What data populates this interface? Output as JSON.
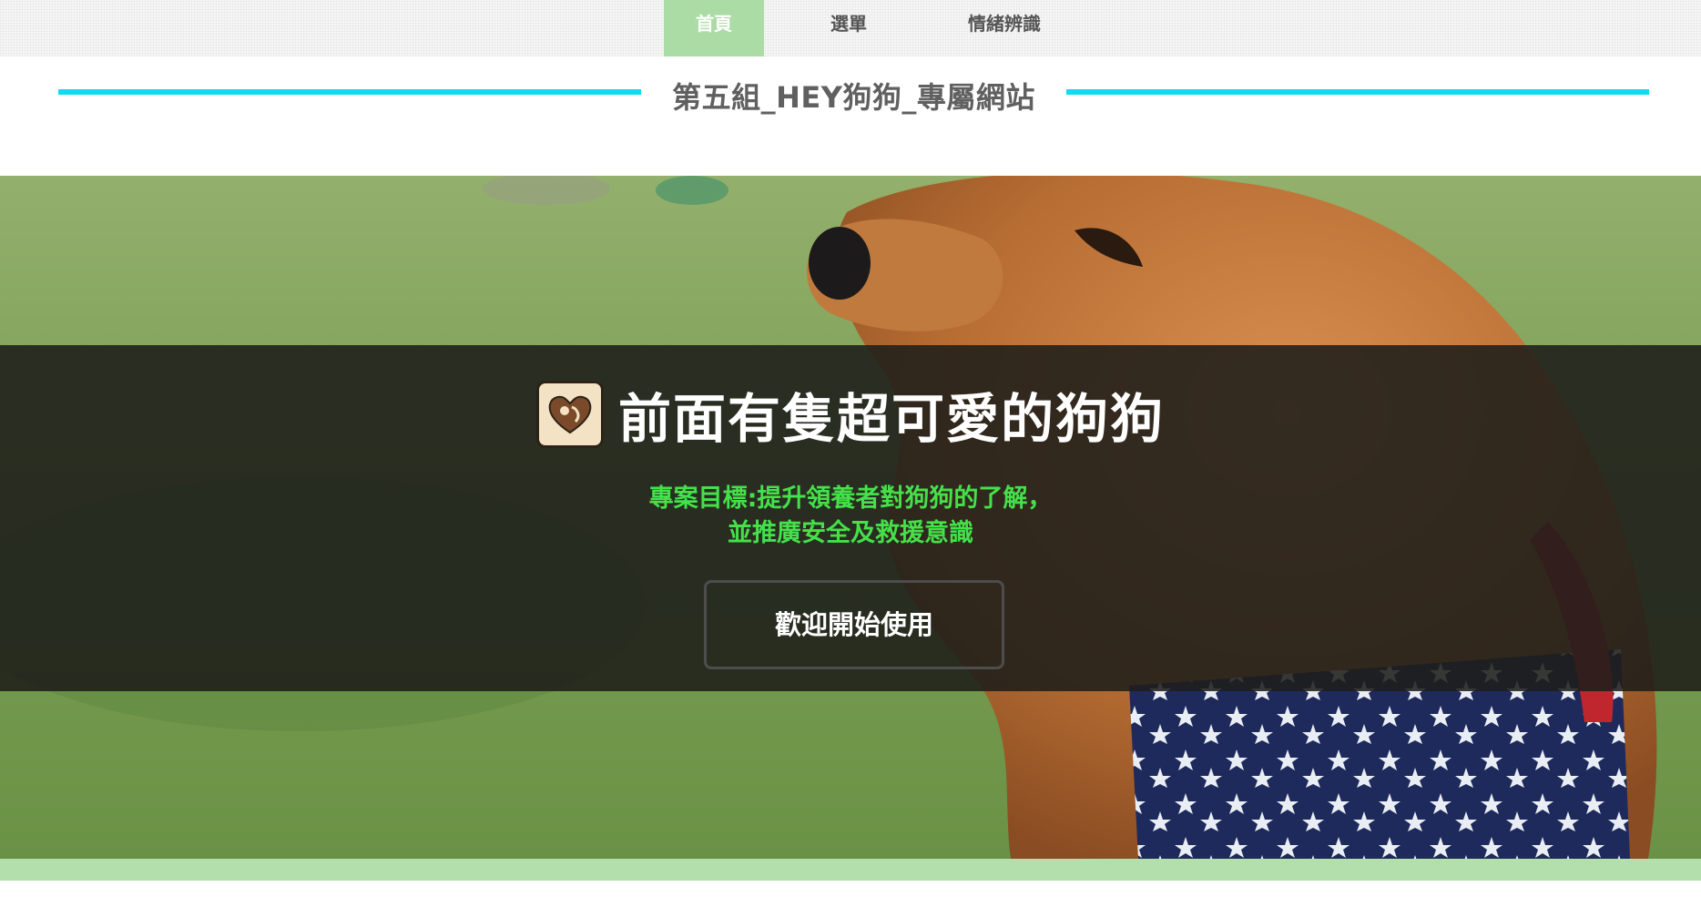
{
  "nav": {
    "items": [
      {
        "label": "首頁",
        "active": true
      },
      {
        "label": "選單",
        "active": false
      },
      {
        "label": "情緒辨識",
        "active": false
      }
    ],
    "active_color": "#acdca6"
  },
  "site": {
    "title": "第五組_HEY狗狗_專屬網站",
    "accent_line_color": "#12dbef"
  },
  "hero": {
    "icon": "dog-heart-icon",
    "headline": "前面有隻超可愛的狗狗",
    "goal_line1": "專案目標:提升領養者對狗狗的了解，",
    "goal_line2": "並推廣安全及救援意識",
    "goal_color": "#45e04a",
    "cta_label": "歡迎開始使用"
  },
  "footer": {
    "strip_color": "#b2dfab"
  }
}
